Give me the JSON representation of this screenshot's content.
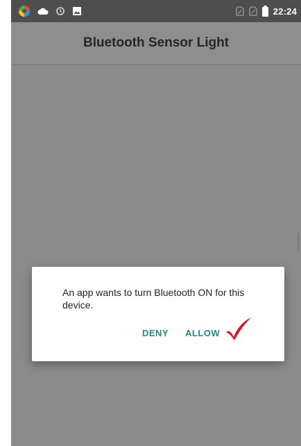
{
  "status_bar": {
    "time": "22:24",
    "icons": [
      "app-color-wheel-icon",
      "cloud-icon",
      "sync-icon",
      "image-icon",
      "sim-no-signal-icon",
      "sim-no-signal-icon",
      "battery-icon"
    ]
  },
  "app_bar": {
    "title": "Bluetooth Sensor Light"
  },
  "dialog": {
    "message": "An app wants to turn Bluetooth ON for this device.",
    "deny_label": "DENY",
    "allow_label": "ALLOW",
    "annotation_icon": "red-checkmark-icon"
  },
  "colors": {
    "status_bar": "#4e4e4e",
    "scrim": "rgba(0,0,0,0.42)",
    "button_accent": "#1e8c86",
    "checkmark": "#e0141e"
  }
}
